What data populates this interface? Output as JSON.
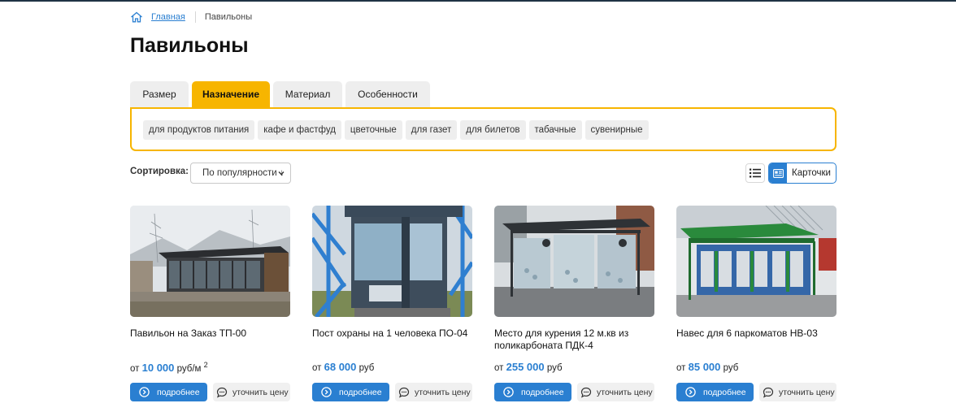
{
  "breadcrumb": {
    "home_label": "Главная",
    "current": "Павильоны"
  },
  "page_title": "Павильоны",
  "filter_tabs": [
    {
      "label": "Размер",
      "active": false
    },
    {
      "label": "Назначение",
      "active": true
    },
    {
      "label": "Материал",
      "active": false
    },
    {
      "label": "Особенности",
      "active": false
    }
  ],
  "filter_chips": [
    "для продуктов питания",
    "кафе и фастфуд",
    "цветочные",
    "для газет",
    "для билетов",
    "табачные",
    "сувенирные"
  ],
  "sort": {
    "label": "Сортировка:",
    "value": "По популярности ↓"
  },
  "view": {
    "cards_label": "Карточки",
    "active": "cards"
  },
  "products": [
    {
      "title": "Павильон на Заказ ТП-00",
      "price_prefix": "от",
      "price": "10 000",
      "unit": "руб/м",
      "unit_sup": "2",
      "more_label": "подробнее",
      "price_label": "уточнить цену"
    },
    {
      "title": "Пост охраны на 1 человека ПО-04",
      "price_prefix": "от",
      "price": "68 000",
      "unit": "руб",
      "unit_sup": "",
      "more_label": "подробнее",
      "price_label": "уточнить цену"
    },
    {
      "title": "Место для курения 12 м.кв из поликарбоната ПДК-4",
      "price_prefix": "от",
      "price": "255 000",
      "unit": "руб",
      "unit_sup": "",
      "more_label": "подробнее",
      "price_label": "уточнить цену"
    },
    {
      "title": "Навес для 6 паркоматов НВ-03",
      "price_prefix": "от",
      "price": "85 000",
      "unit": "руб",
      "unit_sup": "",
      "more_label": "подробнее",
      "price_label": "уточнить цену"
    }
  ],
  "colors": {
    "accent_blue": "#2a7fd1",
    "accent_yellow": "#f7b500",
    "chip_bg": "#eeeeee"
  }
}
